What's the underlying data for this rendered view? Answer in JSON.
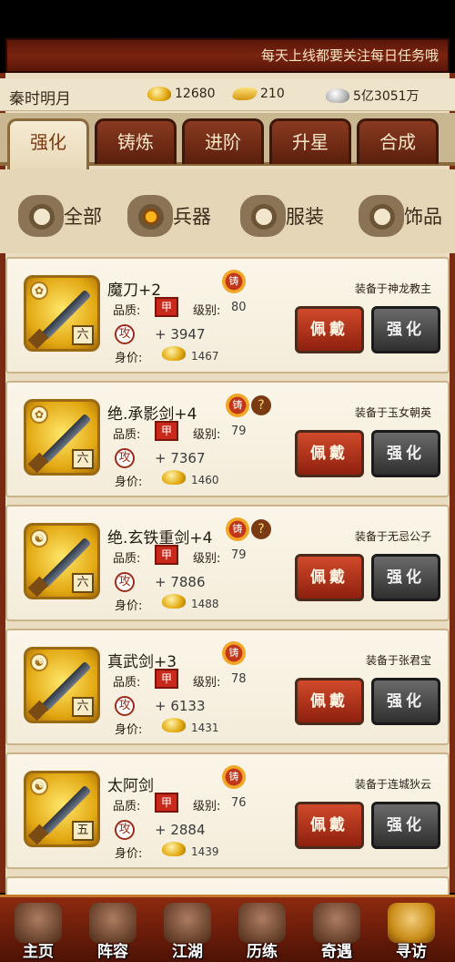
{
  "ticker": "每天上线都要关注每日任务哦",
  "player": {
    "name": "秦时明月",
    "gold_ingots": "12680",
    "gold_bars": "210",
    "silver": "5亿3051万"
  },
  "tabs": [
    {
      "label": "强化",
      "active": true
    },
    {
      "label": "铸炼",
      "active": false
    },
    {
      "label": "进阶",
      "active": false
    },
    {
      "label": "升星",
      "active": false
    },
    {
      "label": "合成",
      "active": false
    }
  ],
  "filters": [
    {
      "label": "全部",
      "selected": false
    },
    {
      "label": "兵器",
      "selected": true
    },
    {
      "label": "服装",
      "selected": false
    },
    {
      "label": "饰品",
      "selected": false
    }
  ],
  "labels": {
    "quality": "品质:",
    "level": "级别:",
    "price": "身价:",
    "quality_badge": "甲",
    "attack_icon": "攻",
    "forge_icon": "铸",
    "wear_button": "佩戴",
    "enhance_button": "强化"
  },
  "items": [
    {
      "name": "魔刀+2",
      "level": "80",
      "attack": "+ 3947",
      "price": "1467",
      "owner": "装备于神龙教主",
      "rank": "六",
      "question": false
    },
    {
      "name": "绝.承影剑+4",
      "level": "79",
      "attack": "+ 7367",
      "price": "1460",
      "owner": "装备于玉女朝英",
      "rank": "六",
      "question": true
    },
    {
      "name": "绝.玄铁重剑+4",
      "level": "79",
      "attack": "+ 7886",
      "price": "1488",
      "owner": "装备于无忌公子",
      "rank": "六",
      "question": true
    },
    {
      "name": "真武剑+3",
      "level": "78",
      "attack": "+ 6133",
      "price": "1431",
      "owner": "装备于张君宝",
      "rank": "六",
      "question": false
    },
    {
      "name": "太阿剑",
      "level": "76",
      "attack": "+ 2884",
      "price": "1439",
      "owner": "装备于连城狄云",
      "rank": "五",
      "question": false
    }
  ],
  "nav": [
    {
      "label": "主页"
    },
    {
      "label": "阵容"
    },
    {
      "label": "江湖"
    },
    {
      "label": "历练"
    },
    {
      "label": "奇遇"
    },
    {
      "label": "寻访"
    }
  ]
}
